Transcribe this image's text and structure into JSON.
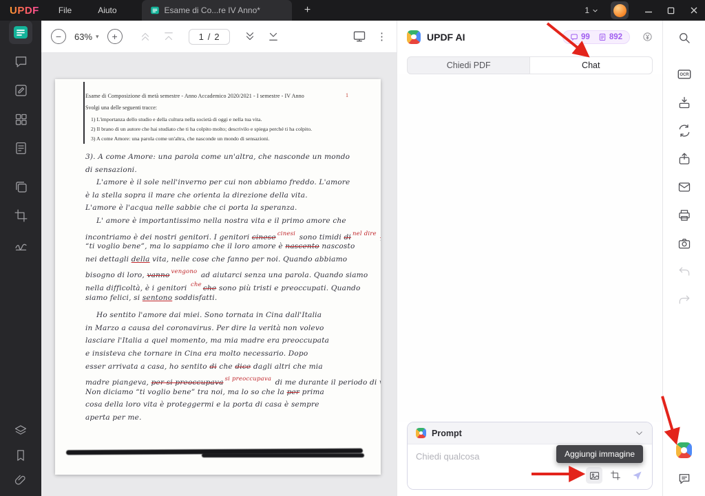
{
  "titlebar": {
    "logo": "UPDF",
    "menus": [
      {
        "label": "File"
      },
      {
        "label": "Aiuto"
      }
    ],
    "tab": {
      "title": "Esame di Co...re IV Anno*"
    },
    "doc_count": "1"
  },
  "icons": {
    "new_tab": "+",
    "zoom_out": "−",
    "zoom_in": "+",
    "zoom_caret": "▾",
    "overflow": "⋮"
  },
  "toolbar": {
    "zoom_level": "63%",
    "page_current": "1",
    "page_sep": "/",
    "page_total": "2"
  },
  "document": {
    "header_line": "Esame di Composizione di metà semestre  -  Anno Accademico 2020/2021 - I semestre - IV Anno",
    "page_number": "1",
    "prompt_line": "Svolgi una delle seguenti tracce:",
    "tracks": [
      "1)  L'importanza dello studio e della cultura nella società di oggi e nella tua vita.",
      "2)  Il brano di un autore che hai studiato che ti ha colpito molto; descrivilo e spiega perché ti ha colpito.",
      "3)  A come Amore: una parola come un'altra, che nasconde un mondo di sensazioni."
    ],
    "handwriting": [
      {
        "seg": [
          {
            "t": "3). A come Amore: una parola come un'altra, che nasconde un mondo"
          }
        ]
      },
      {
        "seg": [
          {
            "t": "di sensazioni."
          }
        ]
      },
      {
        "ind": true,
        "seg": [
          {
            "t": "L'amore è il sole nell'inverno per cui non abbiamo freddo. L'amore"
          }
        ]
      },
      {
        "seg": [
          {
            "t": "è la stella sopra il mare che orienta la direzione della vita."
          }
        ]
      },
      {
        "seg": [
          {
            "t": "L'amore è l'acqua nelle sabbie che ci porta la speranza."
          }
        ]
      },
      {
        "ind": true,
        "seg": [
          {
            "t": "L' amore è importantissimo nella nostra vita e il primo amore che"
          }
        ]
      },
      {
        "seg": [
          {
            "t": "incontriamo è dei nostri genitori. I genitori "
          },
          {
            "t": "cinese",
            "s": "strike"
          },
          {
            "t": "cinesi",
            "s": "redsup"
          },
          {
            "t": " sono timidi "
          },
          {
            "t": "di",
            "s": "strike"
          },
          {
            "t": "nel dire",
            "s": "redsup"
          },
          {
            "t": " "
          },
          {
            "t": "portare",
            "s": "strike"
          }
        ]
      },
      {
        "seg": [
          {
            "t": "“ti voglio bene”, ma lo sappiamo che il loro amore è "
          },
          {
            "t": "nascento",
            "s": "strike"
          },
          {
            "t": " nascosto"
          }
        ]
      },
      {
        "seg": [
          {
            "t": "nei dettagli "
          },
          {
            "t": "della",
            "s": "redul"
          },
          {
            "t": " vita, nelle cose che fanno per noi. Quando abbiamo"
          }
        ]
      },
      {
        "seg": [
          {
            "t": "bisogno di loro, "
          },
          {
            "t": "vanno",
            "s": "strike"
          },
          {
            "t": "vengono",
            "s": "redsup"
          },
          {
            "t": " ad aiutarci senza una parola. Quando siamo"
          }
        ]
      },
      {
        "seg": [
          {
            "t": "nella difficoltà, è i genitori "
          },
          {
            "t": "che",
            "s": "redsup"
          },
          {
            "t": "che",
            "s": "strike"
          },
          {
            "t": " sono più tristi e preoccupati. Quando"
          }
        ]
      },
      {
        "seg": [
          {
            "t": "siamo felici, si "
          },
          {
            "t": "sentono",
            "s": "redul"
          },
          {
            "t": " soddisfatti."
          }
        ]
      },
      {
        "ind": true,
        "gap": true,
        "seg": [
          {
            "t": "Ho sentito l'amore dai miei. Sono tornata in Cina dall'Italia"
          }
        ]
      },
      {
        "seg": [
          {
            "t": "in Marzo a causa del coronavirus. Per dire la verità non volevo"
          }
        ]
      },
      {
        "seg": [
          {
            "t": "lasciare l'Italia a quel momento, ma mia madre era preoccupata"
          }
        ]
      },
      {
        "seg": [
          {
            "t": "e insisteva che tornare in Cina era molto necessario. Dopo"
          }
        ]
      },
      {
        "seg": [
          {
            "t": "esser arrivata a casa, ho sentito "
          },
          {
            "t": "di",
            "s": "strike"
          },
          {
            "t": " che "
          },
          {
            "t": "dice",
            "s": "strike"
          },
          {
            "t": " dagli altri che mia"
          }
        ]
      },
      {
        "seg": [
          {
            "t": "madre piangeva, "
          },
          {
            "t": "per si preoccupava",
            "s": "strike"
          },
          {
            "t": "si preoccupava",
            "s": "redsup"
          },
          {
            "t": " di me durante il periodo di virus."
          }
        ]
      },
      {
        "seg": [
          {
            "t": "Non diciamo “ti voglio bene” tra noi, ma lo so che la "
          },
          {
            "t": "per",
            "s": "strike"
          },
          {
            "t": " prima"
          }
        ]
      },
      {
        "seg": [
          {
            "t": "cosa della loro vita è proteggermi e la porta di casa è sempre"
          }
        ]
      },
      {
        "seg": [
          {
            "t": "aperta per me."
          }
        ]
      }
    ]
  },
  "ai_panel": {
    "title": "UPDF AI",
    "credits": [
      {
        "value": "99"
      },
      {
        "value": "892"
      }
    ],
    "tabs": [
      {
        "label": "Chiedi PDF",
        "active": false
      },
      {
        "label": "Chat",
        "active": true
      }
    ],
    "prompt_label": "Prompt",
    "input_placeholder": "Chiedi qualcosa",
    "tooltip": "Aggiungi immagine"
  },
  "right_rail": {
    "ocr_label": "OCR"
  },
  "colors": {
    "accent_teal": "#14b39a",
    "ai_purple": "#a05df0",
    "annotation_red": "#e3241b",
    "correction_red": "#c0262b"
  }
}
